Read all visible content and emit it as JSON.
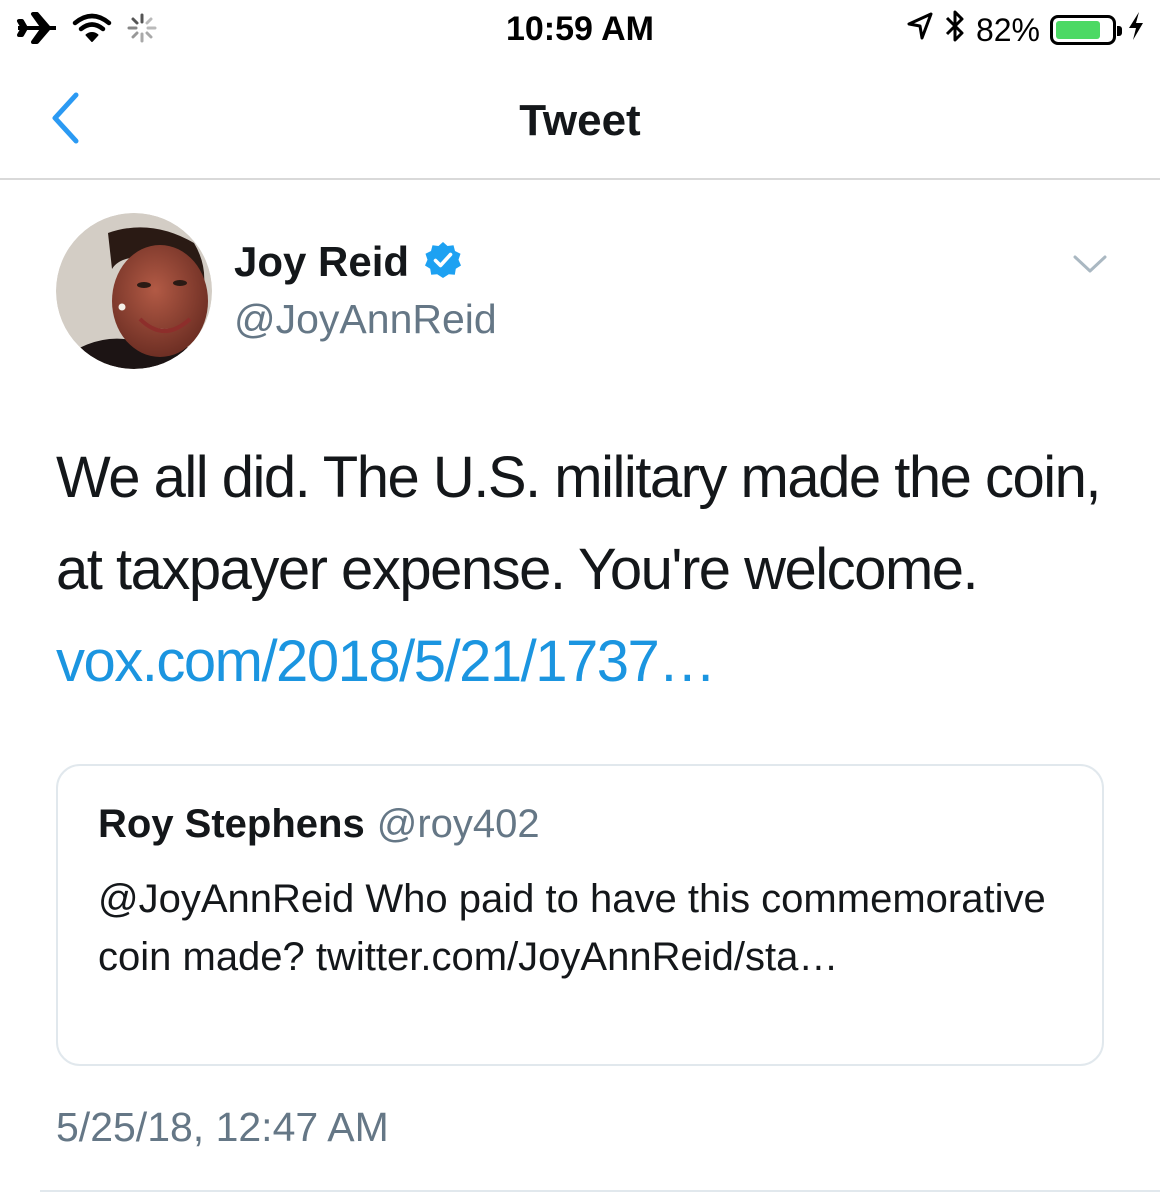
{
  "status_bar": {
    "time": "10:59 AM",
    "battery_percent": "82%",
    "battery_level": 0.82,
    "icons": [
      "airplane-icon",
      "wifi-icon",
      "activity-spinner-icon",
      "location-arrow-icon",
      "bluetooth-icon",
      "battery-icon",
      "charging-bolt-icon"
    ]
  },
  "nav": {
    "title": "Tweet",
    "back_icon": "chevron-left-icon"
  },
  "tweet": {
    "author_name": "Joy Reid",
    "author_handle": "@JoyAnnReid",
    "verified": true,
    "text": "We all did. The U.S. military made the coin, at taxpayer expense. You're welcome. ",
    "link_text": "vox.com/2018/5/21/1737…",
    "timestamp": "5/25/18, 12:47 AM"
  },
  "quoted_tweet": {
    "author_name": "Roy Stephens",
    "author_handle": "@roy402",
    "text": "@JoyAnnReid Who paid to have this commemorative coin made? twitter.com/JoyAnnReid/sta…"
  },
  "colors": {
    "link": "#1b95e0",
    "ios_blue": "#2b9af3",
    "verified_badge": "#1da1f2",
    "secondary_text": "#657786",
    "battery_fill": "#4cd964"
  }
}
